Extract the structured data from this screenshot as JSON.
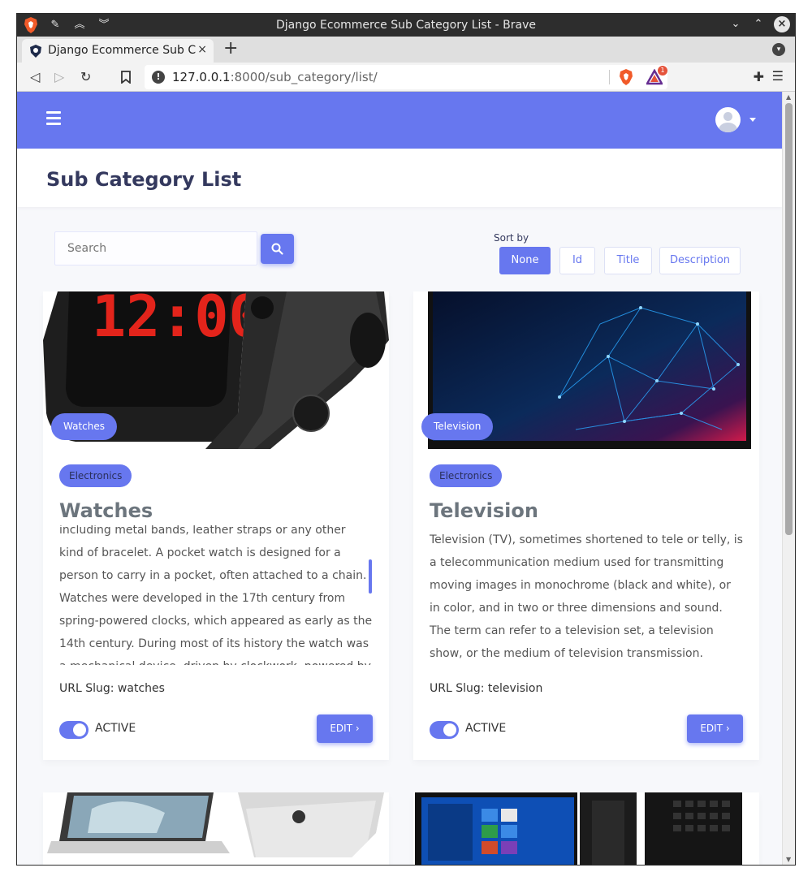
{
  "window": {
    "title": "Django Ecommerce Sub Category List - Brave"
  },
  "tab": {
    "title": "Django Ecommerce Sub Cat",
    "close": "×"
  },
  "browser": {
    "url_host": "127.0.0.1",
    "url_rest": ":8000/sub_category/list/",
    "rewards_count": "1"
  },
  "page": {
    "title": "Sub Category List",
    "search_placeholder": "Search",
    "sort_label": "Sort by",
    "sort_options": [
      "None",
      "Id",
      "Title",
      "Description"
    ],
    "sort_active": "None"
  },
  "cards": [
    {
      "image_label": "Watches",
      "category": "Electronics",
      "title": "Watches",
      "description": "including metal bands, leather straps or any other kind of bracelet. A pocket watch is designed for a person to carry in a pocket, often attached to a chain. Watches were developed in the 17th century from spring-powered clocks, which appeared as early as the 14th century. During most of its history the watch was a mechanical device, driven by clockwork, powered by winding a mainspring, and keeping",
      "slug": "URL Slug: watches",
      "status": "ACTIVE",
      "edit": "EDIT"
    },
    {
      "image_label": "Television",
      "category": "Electronics",
      "title": "Television",
      "description": "Television (TV), sometimes shortened to tele or telly, is a telecommunication medium used for transmitting moving images in monochrome (black and white), or in color, and in two or three dimensions and sound. The term can refer to a television set, a television show, or the medium of television transmission. Television is a mass medium for advertising,",
      "slug": "URL Slug: television",
      "status": "ACTIVE",
      "edit": "EDIT"
    }
  ],
  "colors": {
    "accent": "#6777ef",
    "title_text": "#34395e"
  }
}
